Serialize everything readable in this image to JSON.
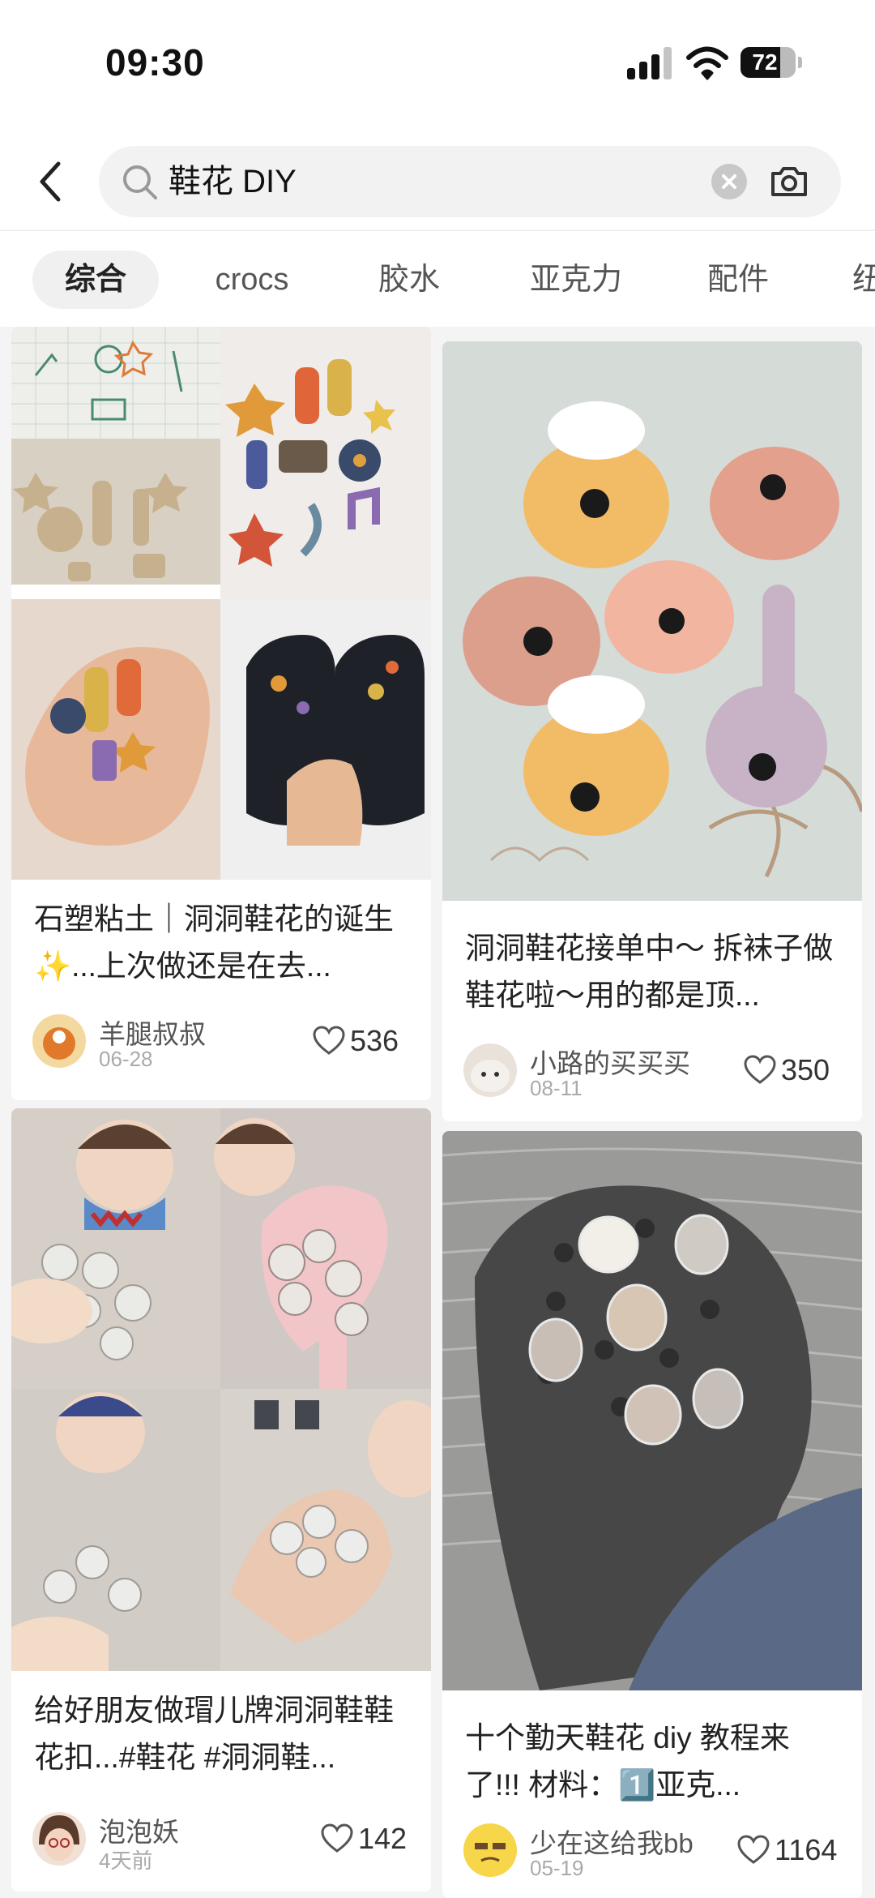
{
  "status_bar": {
    "time": "09:30",
    "battery": "72",
    "battery_level": 0.72
  },
  "search": {
    "query": "鞋花 DIY"
  },
  "tabs": [
    {
      "label": "综合",
      "active": true
    },
    {
      "label": "crocs",
      "active": false
    },
    {
      "label": "胶水",
      "active": false
    },
    {
      "label": "亚克力",
      "active": false
    },
    {
      "label": "配件",
      "active": false
    },
    {
      "label": "纽",
      "active": false
    }
  ],
  "posts": [
    {
      "title": "石塑粘土｜洞洞鞋花的诞生✨...上次做还是在去...",
      "author": "羊腿叔叔",
      "date": "06-28",
      "likes": "536"
    },
    {
      "title": "洞洞鞋花接单中～ 拆袜子做鞋花啦～用的都是顶...",
      "author": "小路的买买买",
      "date": "08-11",
      "likes": "350"
    },
    {
      "title": "给好朋友做瑁儿牌洞洞鞋鞋花扣...#鞋花 #洞洞鞋...",
      "author": "泡泡妖",
      "date": "4天前",
      "likes": "142"
    },
    {
      "title": "十个勤天鞋花 diy 教程来了!!!  材料：1️⃣亚克...",
      "author": "少在这给我bb",
      "date": "05-19",
      "likes": "1164"
    }
  ],
  "colors": {
    "accent": "#222222",
    "background": "#f4f4f4",
    "card": "#ffffff",
    "muted": "#aaaaaa"
  }
}
